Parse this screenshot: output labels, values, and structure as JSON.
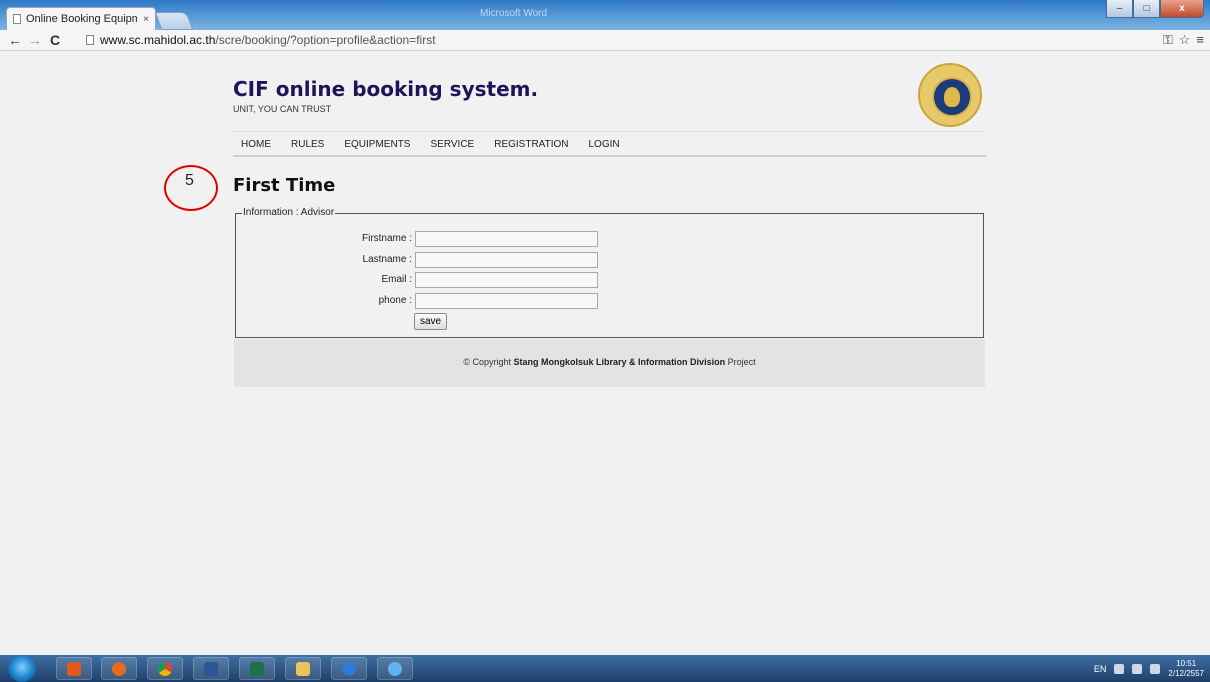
{
  "browser": {
    "tab_title": "Online Booking Equipmen",
    "tab_close": "×",
    "window_title": "Microsoft Word",
    "url_domain": "www.sc.mahidol.ac.th",
    "url_path": "/scre/booking/?option=profile&action=first",
    "back": "←",
    "forward": "→",
    "reload": "C",
    "wrench": "≡",
    "star": "☆",
    "key": "⚿",
    "minimize": "–",
    "maximize": "□",
    "close": "x"
  },
  "site": {
    "title": "CIF online booking system.",
    "tagline": "UNIT, YOU CAN TRUST"
  },
  "menu": [
    {
      "label": "HOME"
    },
    {
      "label": "RULES"
    },
    {
      "label": "EQUIPMENTS"
    },
    {
      "label": "SERVICE"
    },
    {
      "label": "REGISTRATION"
    },
    {
      "label": "LOGIN"
    }
  ],
  "annotation": {
    "number": "5",
    "color": "#e00000"
  },
  "page": {
    "title": "First Time",
    "legend": "Information : Advisor",
    "fields": [
      {
        "label": "Firstname :",
        "value": ""
      },
      {
        "label": "Lastname :",
        "value": ""
      },
      {
        "label": "Email :",
        "value": ""
      },
      {
        "label": "phone :",
        "value": ""
      }
    ],
    "save_label": "save"
  },
  "footer": {
    "prefix": "© Copyright ",
    "bold": "Stang Mongkolsuk Library & Information Division",
    "suffix": " Project"
  },
  "taskbar": {
    "apps": [
      "media-player",
      "firefox",
      "chrome",
      "word",
      "excel",
      "explorer",
      "teamviewer",
      "internet-explorer"
    ],
    "lang": "EN",
    "time": "10:51",
    "date": "2/12/2557"
  },
  "colors": {
    "title": "#1c1557",
    "page_bg": "#f1f1f1",
    "footer_bg": "#e3e3e3"
  }
}
